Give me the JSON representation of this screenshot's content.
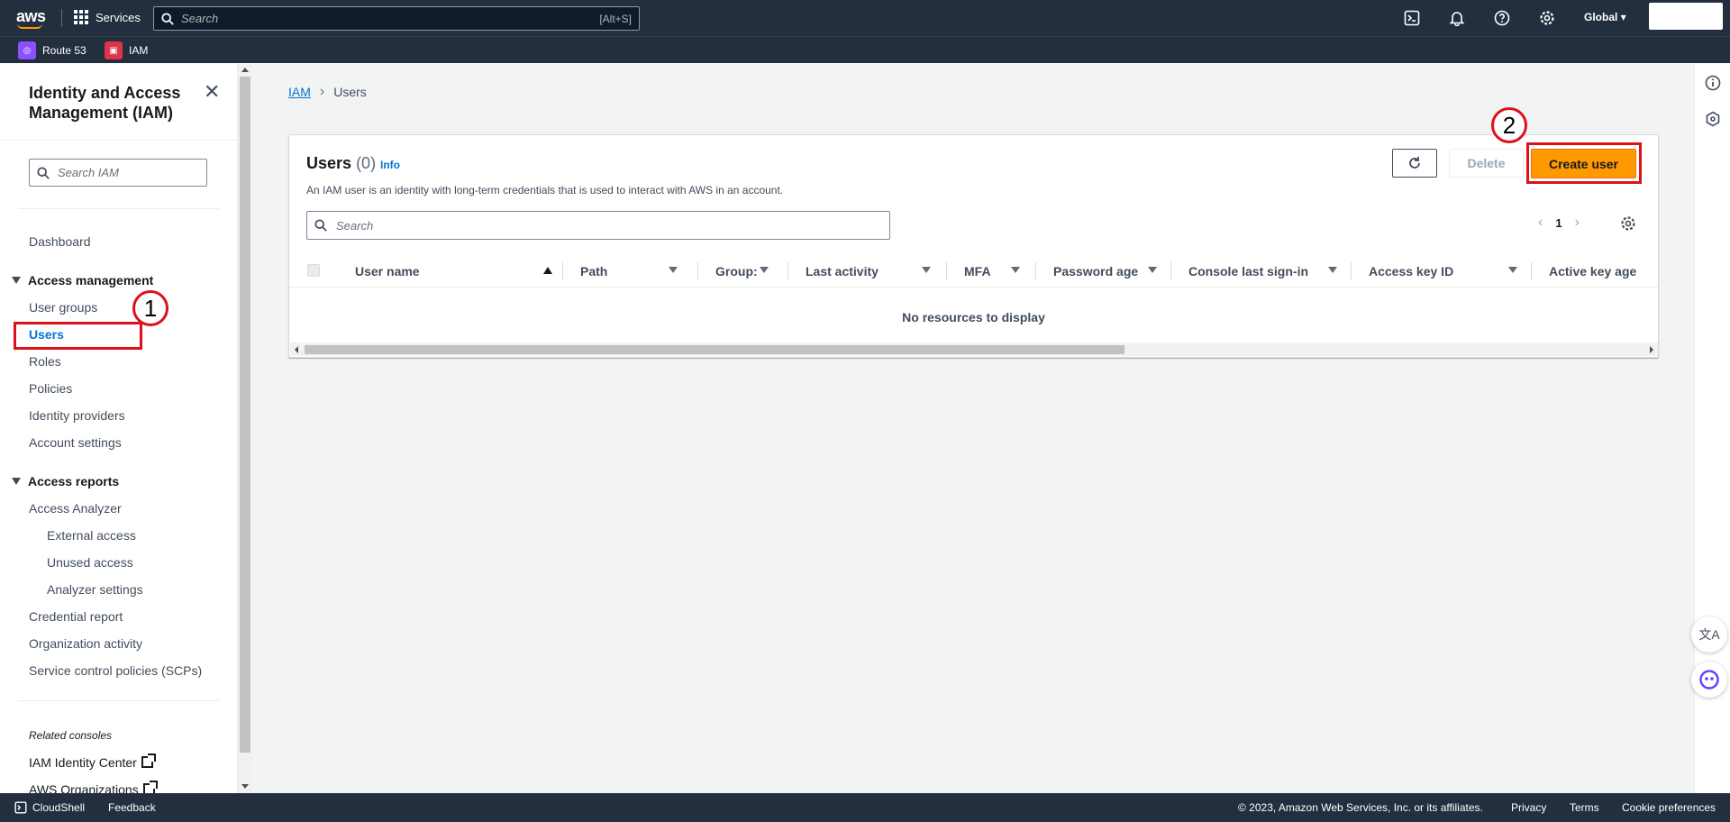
{
  "topbar": {
    "logo": "aws",
    "services_label": "Services",
    "search_placeholder": "Search",
    "search_shortcut": "[Alt+S]",
    "region": "Global ▾"
  },
  "favorites": [
    {
      "label": "Route 53",
      "color": "#8c4fff"
    },
    {
      "label": "IAM",
      "color": "#dd344c"
    }
  ],
  "sidenav": {
    "title": "Identity and Access Management (IAM)",
    "search_placeholder": "Search IAM",
    "dashboard": "Dashboard",
    "access_management": {
      "heading": "Access management",
      "items": [
        "User groups",
        "Users",
        "Roles",
        "Policies",
        "Identity providers",
        "Account settings"
      ]
    },
    "access_reports": {
      "heading": "Access reports",
      "analyzer": "Access Analyzer",
      "analyzer_items": [
        "External access",
        "Unused access",
        "Analyzer settings"
      ],
      "items": [
        "Credential report",
        "Organization activity",
        "Service control policies (SCPs)"
      ]
    },
    "related_heading": "Related consoles",
    "related": [
      "IAM Identity Center",
      "AWS Organizations"
    ]
  },
  "breadcrumb": {
    "root": "IAM",
    "current": "Users"
  },
  "panel": {
    "title": "Users",
    "count": "(0)",
    "info": "Info",
    "description": "An IAM user is an identity with long-term credentials that is used to interact with AWS in an account.",
    "delete_label": "Delete",
    "create_label": "Create user",
    "search_placeholder": "Search",
    "page": "1",
    "columns": [
      "User name",
      "Path",
      "Group:",
      "Last activity",
      "MFA",
      "Password age",
      "Console last sign-in",
      "Access key ID",
      "Active key age"
    ],
    "empty_text": "No resources to display"
  },
  "footer": {
    "cloudshell": "CloudShell",
    "feedback": "Feedback",
    "copyright": "© 2023, Amazon Web Services, Inc. or its affiliates.",
    "privacy": "Privacy",
    "terms": "Terms",
    "cookies": "Cookie preferences"
  },
  "annotations": {
    "step1": "1",
    "step2": "2"
  },
  "colors": {
    "topbar": "#232f3e",
    "accent": "#ff9900",
    "link": "#0972d3",
    "annotation": "#e0101a"
  }
}
